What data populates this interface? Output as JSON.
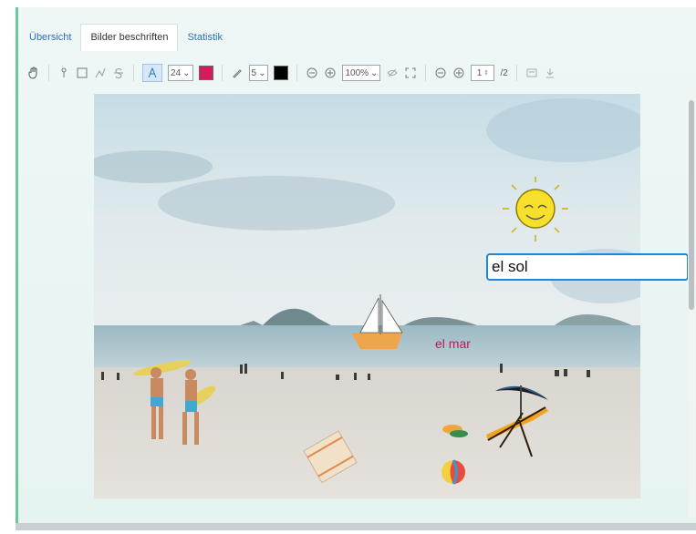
{
  "tabs": [
    {
      "label": "Übersicht"
    },
    {
      "label": "Bilder beschriften"
    },
    {
      "label": "Statistik"
    }
  ],
  "toolbar": {
    "font_size": "24",
    "text_color": "#d81b60",
    "stroke_width": "5",
    "stroke_color": "#000000",
    "zoom": "100%",
    "page_current": "1",
    "page_total": "/2"
  },
  "canvas": {
    "scene_labels": {
      "sea": "el mar"
    }
  },
  "label_input": {
    "value": "el sol"
  }
}
